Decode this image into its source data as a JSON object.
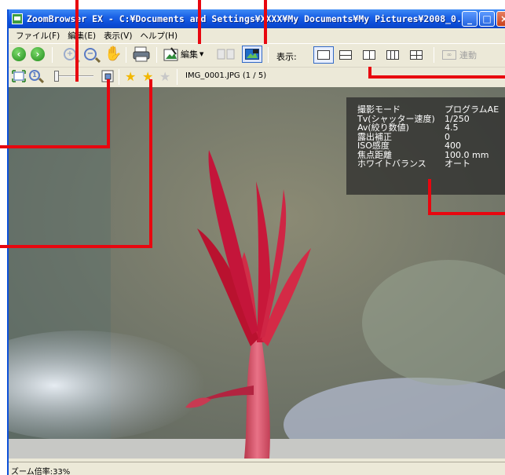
{
  "window": {
    "title": "ZoomBrowser EX - C:¥Documents and Settings¥XXXX¥My Documents¥My Pictures¥2008_0...",
    "controls": [
      "minimize",
      "maximize",
      "close"
    ]
  },
  "menubar": {
    "items": [
      {
        "label": "ファイル(F)"
      },
      {
        "label": "編集(E)"
      },
      {
        "label": "表示(V)"
      },
      {
        "label": "ヘルプ(H)"
      }
    ]
  },
  "toolbar": {
    "back_icon": "arrow-left-icon",
    "forward_icon": "arrow-right-icon",
    "zoom_in_icon": "zoom-in-icon",
    "zoom_out_icon": "zoom-out-icon",
    "hand_icon": "hand-icon",
    "print_icon": "printer-icon",
    "edit_label": "編集",
    "view_label": "表示:",
    "sync_label": "連動",
    "view_modes": [
      "single",
      "horizontal-split",
      "two-column",
      "three-column",
      "grid"
    ],
    "active_view_mode": "single"
  },
  "toolbar2": {
    "file_info": "IMG_0001.JPG (1 / 5)",
    "rating_stars": 2,
    "rating_max": 3
  },
  "shooting_info": {
    "rows": [
      {
        "label": "撮影モード",
        "value": "プログラムAE"
      },
      {
        "label": "Tv(シャッター速度)",
        "value": "1/250"
      },
      {
        "label": "Av(絞り数値)",
        "value": "4.5"
      },
      {
        "label": "露出補正",
        "value": "0"
      },
      {
        "label": "ISO感度",
        "value": "400"
      },
      {
        "label": "焦点距離",
        "value": "100.0 mm"
      },
      {
        "label": "ホワイトバランス",
        "value": "オート"
      }
    ]
  },
  "status_bar": {
    "zoom_text": "ズーム倍率:33%"
  },
  "colors": {
    "callout": "#e8060f",
    "titlebar": "#0a4ad6",
    "chrome": "#ece9d8"
  }
}
